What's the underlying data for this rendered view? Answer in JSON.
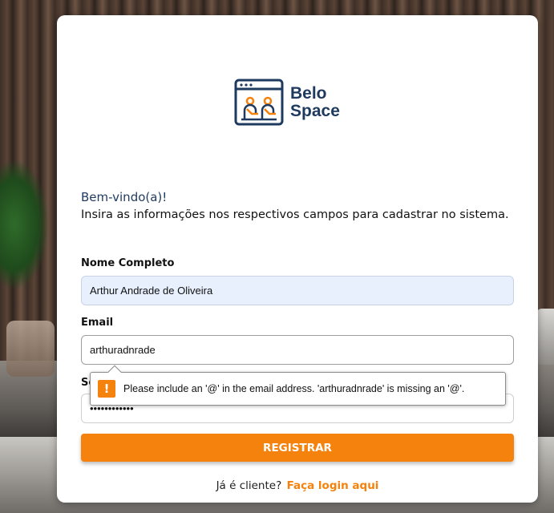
{
  "brand": {
    "line1": "Belo",
    "line2": "Space",
    "color": "#1e3a5f",
    "accent": "#f5820d"
  },
  "heading": {
    "welcome": "Bem-vindo(a)!",
    "subtitle": "Insira as informações nos respectivos campos para cadastrar no sistema."
  },
  "form": {
    "name_label": "Nome Completo",
    "name_value": "Arthur Andrade de Oliveira",
    "email_label": "Email",
    "email_value": "arthuradnrade",
    "password_label": "Senha",
    "password_value": "••••••••••••",
    "submit_label": "REGISTRAR"
  },
  "footer": {
    "text": "Já é cliente?",
    "link": "Faça login aqui"
  },
  "validation": {
    "icon": "warning-icon",
    "message": "Please include an '@' in the email address. 'arthuradnrade' is missing an '@'."
  }
}
